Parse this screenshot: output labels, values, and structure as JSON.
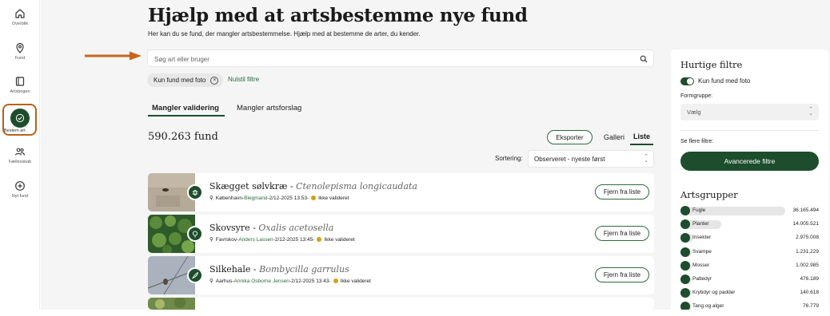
{
  "nav": {
    "items": [
      {
        "label": "Overblik",
        "icon": "home-icon"
      },
      {
        "label": "Fund",
        "icon": "map-pin-icon"
      },
      {
        "label": "Artsbogen",
        "icon": "book-icon"
      },
      {
        "label": "Bestem art",
        "icon": "check-circle-icon",
        "active": true
      },
      {
        "label": "Fællesskab",
        "icon": "people-icon"
      },
      {
        "label": "Nyt fund",
        "icon": "plus-circle-icon"
      }
    ]
  },
  "page": {
    "title": "Hjælp med at artsbestemme nye fund",
    "help_mark": "?",
    "subtitle": "Her kan du se fund, der mangler artsbestemmelse. Hjælp med at bestemme de arter, du kender."
  },
  "search": {
    "placeholder": "Søg art eller bruger"
  },
  "filters": {
    "active_chip": "Kun fund med foto",
    "reset_label": "Nulstil filtre"
  },
  "tabs": [
    {
      "label": "Mangler validering",
      "active": true
    },
    {
      "label": "Mangler artsforslag",
      "active": false
    }
  ],
  "results": {
    "count": "590.263 fund",
    "export_label": "Eksporter",
    "view_gallery": "Galleri",
    "view_list": "Liste",
    "sort_label": "Sortering:",
    "sort_value": "Observeret - nyeste først"
  },
  "cards": [
    {
      "common": "Skægget sølvkræ",
      "scientific": "Ctenolepisma longicaudata",
      "location": "København",
      "user": "Blegmand",
      "date": "2/12-2025 13:53",
      "status": "Ikke valideret",
      "button": "Fjern fra liste",
      "group_icon": "insect-icon"
    },
    {
      "common": "Skovsyre",
      "scientific": "Oxalis acetosella",
      "location": "Favrskov",
      "user": "Anders Lassen",
      "date": "2/12-2025 13:45",
      "status": "Ikke valideret",
      "button": "Fjern fra liste",
      "group_icon": "plant-icon"
    },
    {
      "common": "Silkehale",
      "scientific": "Bombycilla garrulus",
      "location": "Aarhus",
      "user": "Annika Osborne Jensen",
      "date": "2/12-2025 13:43",
      "status": "Ikke valideret",
      "button": "Fjern fra liste",
      "group_icon": "feather-icon"
    }
  ],
  "meta_separator": " - ",
  "panel": {
    "title": "Hurtige filtre",
    "toggle_label": "Kun fund med foto",
    "form_label": "Formgruppe:",
    "form_value": "Vælg",
    "more_label": "Se flere filtre:",
    "advanced_button": "Avancerede filtre",
    "groups_title": "Artsgrupper",
    "groups": [
      {
        "name": "Fugle",
        "count": "36.165.494",
        "share": 1.0
      },
      {
        "name": "Planter",
        "count": "14.005.521",
        "share": 0.39
      },
      {
        "name": "Insekter",
        "count": "2.975.008",
        "share": 0.12
      },
      {
        "name": "Svampe",
        "count": "1.231.229",
        "share": 0.06
      },
      {
        "name": "Mosser",
        "count": "1.002.985",
        "share": 0.05
      },
      {
        "name": "Pattedyr",
        "count": "476.189",
        "share": 0.03
      },
      {
        "name": "Krybdyr og padder",
        "count": "140.618",
        "share": 0.02
      },
      {
        "name": "Tang og alger",
        "count": "76.779",
        "share": 0.01
      }
    ]
  },
  "colors": {
    "accent": "#1d4d2c",
    "arrow": "#c8641e",
    "active_outline": "#b8621a",
    "status_dot": "#d4a017"
  }
}
